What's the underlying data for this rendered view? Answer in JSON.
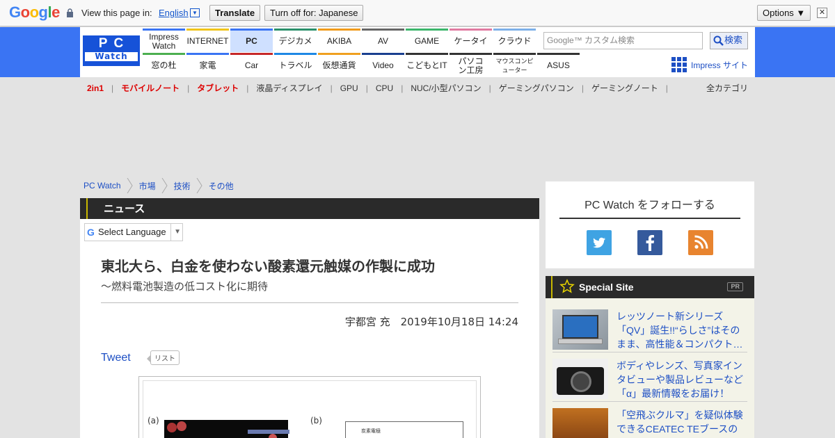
{
  "google_translate_bar": {
    "logo": "Google",
    "view_page_in": "View this page in:",
    "language": "English",
    "translate_button": "Translate",
    "turn_off_button": "Turn off for: Japanese",
    "options_button": "Options ▼",
    "close_glyph": "✕"
  },
  "header": {
    "logo_top": "PC",
    "logo_bottom": "Watch",
    "nav_row1": [
      "Impress Watch",
      "INTERNET",
      "PC",
      "デジカメ",
      "AKIBA",
      "AV",
      "GAME",
      "ケータイ",
      "クラウド"
    ],
    "nav_row2": [
      "窓の杜",
      "家電",
      "Car",
      "トラベル",
      "仮想通貨",
      "Video",
      "こどもとIT",
      "パソコン工房",
      "マウスコンピューター",
      "ASUS"
    ],
    "nav_colors_row1": [
      "#3a74f3",
      "#f0c419",
      "#3a74f3",
      "#2a8f6a",
      "#f09a1a",
      "#666666",
      "#3bb56b",
      "#e07aa0",
      "#7db0e8"
    ],
    "nav_colors_row2": [
      "#4caf50",
      "#3a74f3",
      "#c62828",
      "#1e88e5",
      "#f0a020",
      "#1a3f8f",
      "#333333",
      "#333333",
      "#333333",
      "#333333"
    ],
    "search_placeholder": "Google™ カスタム検索",
    "search_button": "検索",
    "impress_site": "Impress サイト"
  },
  "subnav": {
    "red_items": [
      "2in1",
      "モバイルノート",
      "タブレット"
    ],
    "items": [
      "液晶ディスプレイ",
      "GPU",
      "CPU",
      "NUC/小型パソコン",
      "ゲーミングパソコン",
      "ゲーミングノート"
    ],
    "all_categories": "全カテゴリ"
  },
  "breadcrumb": [
    "PC Watch",
    "市場",
    "技術",
    "その他"
  ],
  "article": {
    "section": "ニュース",
    "select_language": "Select Language",
    "title": "東北大ら、白金を使わない酸素還元触媒の作製に成功",
    "subtitle": "～燃料電池製造の低コスト化に期待",
    "byline": "宇都宮 充　2019年10月18日 14:24",
    "tweet": "Tweet",
    "list": "リスト",
    "figure_label_a": "(a)",
    "figure_label_b": "(b)",
    "figure_legend": "炭素電極"
  },
  "sidebar": {
    "follow_title": "PC Watch をフォローする",
    "social": [
      "twitter",
      "facebook",
      "rss"
    ],
    "special_title": "Special Site",
    "pr": "PR",
    "special_items": [
      "レッツノート新シリーズ「QV」誕生!!“らしさ”はそのまま、高性能＆コンパクト…",
      "ボディやレンズ、写真家インタビューや製品レビューなど「α」最新情報をお届け！",
      "「空飛ぶクルマ」を疑似体験できるCEATEC TEブースの"
    ]
  }
}
